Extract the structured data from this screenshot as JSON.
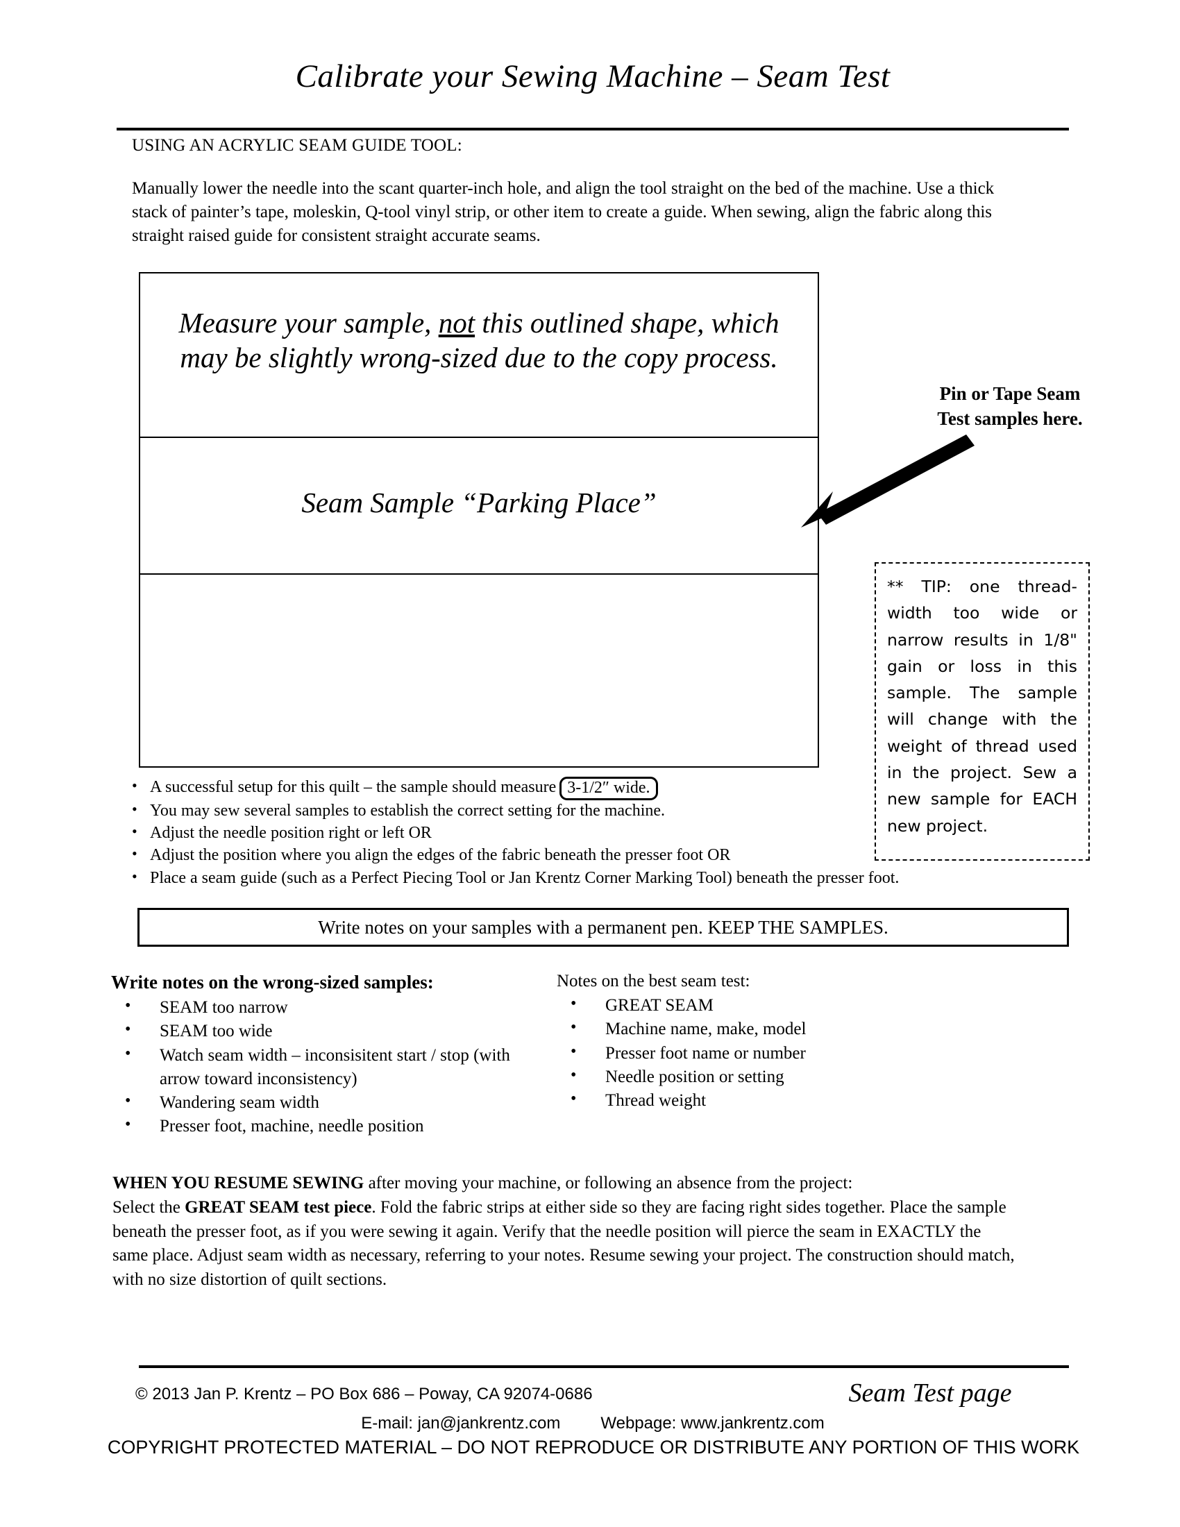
{
  "document": {
    "title": "Calibrate your Sewing Machine – Seam Test",
    "section_label": "USING AN ACRYLIC SEAM GUIDE TOOL:",
    "intro_paragraph": "Manually lower the needle into the scant quarter-inch hole, and align the tool straight on the bed of the machine. Use a thick stack of painter’s tape, moleskin, Q-tool vinyl strip, or other item to create a guide. When sewing, align the fabric along this straight raised guide for consistent straight accurate seams."
  },
  "sample_box": {
    "measure_note_pre": "Measure your sample, ",
    "measure_note_underlined": "not",
    "measure_note_post": " this outlined shape, which may be slightly wrong-sized due to the copy process.",
    "parking_place_label": "Seam Sample “Parking Place”"
  },
  "callout": {
    "pin_or_tape": "Pin or Tape Seam Test samples here.",
    "arrow_icon": "arrow-down-left-icon"
  },
  "tip_box": {
    "text": "**  TIP: one thread-width too wide or narrow results in 1/8\" gain or loss in this sample. The sample will change with the weight of thread used in the project. Sew a new sample for EACH new project."
  },
  "setup_bullets": {
    "item_1_pre": "A successful setup for this quilt – the sample should measure",
    "item_1_chip": "3-1/2″ wide.",
    "items": [
      "You may sew several samples to establish the correct setting for the machine.",
      "Adjust the needle position right or left OR",
      "Adjust the position where you align the edges of the fabric beneath the presser foot OR",
      "Place a seam guide (such as a Perfect Piecing Tool or Jan Krentz Corner Marking Tool) beneath the presser foot."
    ]
  },
  "keep_banner": {
    "text": "Write notes on your samples with a permanent pen. KEEP THE SAMPLES."
  },
  "notes_left": {
    "heading": "Write notes on the wrong-sized samples:",
    "items": [
      "SEAM too narrow",
      "SEAM too wide",
      "Watch seam width – inconsisitent start / stop (with arrow toward inconsistency)",
      "Wandering seam width",
      "Presser foot, machine, needle position"
    ]
  },
  "notes_right": {
    "heading": "Notes on the best seam test:",
    "items": [
      "GREAT SEAM",
      "Machine name, make, model",
      "Presser foot name or number",
      "Needle position or setting",
      "Thread weight"
    ]
  },
  "resume": {
    "bold_lead": "WHEN YOU RESUME SEWING",
    "after_lead": " after moving your machine, or following an absence from the project:",
    "line2_pre": "Select the ",
    "line2_bold": "GREAT SEAM test piece",
    "line2_post": ".  Fold the fabric strips at either side so they are facing right sides together. Place the sample beneath the presser foot, as if you were sewing it again. Verify that the needle position will pierce the seam in EXACTLY the same place. Adjust seam width as necessary, referring to your notes. Resume sewing your project. The construction should match, with no size distortion of quilt sections."
  },
  "footer": {
    "copyright_line": "© 2013 Jan P. Krentz – PO Box 686 – Poway, CA 92074-0686",
    "email_label": "E-mail:  jan@jankrentz.com",
    "webpage_label": "Webpage: www.jankrentz.com",
    "protected_line": "COPYRIGHT PROTECTED MATERIAL – DO NOT REPRODUCE OR DISTRIBUTE ANY PORTION OF THIS WORK",
    "page_name": "Seam Test page"
  }
}
